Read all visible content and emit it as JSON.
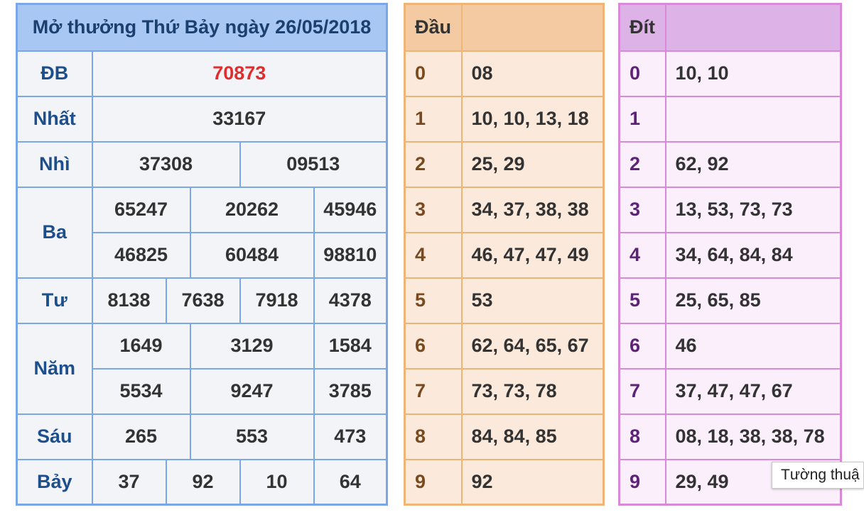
{
  "results": {
    "title": "Mở thưởng Thứ Bảy ngày 26/05/2018",
    "rows": {
      "db": {
        "label": "ĐB",
        "values": [
          "70873"
        ]
      },
      "nhat": {
        "label": "Nhất",
        "values": [
          "33167"
        ]
      },
      "nhi": {
        "label": "Nhì",
        "values": [
          "37308",
          "09513"
        ]
      },
      "ba": {
        "label": "Ba",
        "values": [
          "65247",
          "20262",
          "45946",
          "46825",
          "60484",
          "98810"
        ]
      },
      "tu": {
        "label": "Tư",
        "values": [
          "8138",
          "7638",
          "7918",
          "4378"
        ]
      },
      "nam": {
        "label": "Năm",
        "values": [
          "1649",
          "3129",
          "1584",
          "5534",
          "9247",
          "3785"
        ]
      },
      "sau": {
        "label": "Sáu",
        "values": [
          "265",
          "553",
          "473"
        ]
      },
      "bay": {
        "label": "Bảy",
        "values": [
          "37",
          "92",
          "10",
          "64"
        ]
      }
    },
    "colors": {
      "border": "#7aa7e8",
      "header_bg": "#a9c7f3",
      "special_prize": "#e02d2d",
      "label": "#1d4f8c"
    }
  },
  "dau": {
    "header": "Đầu",
    "rows": [
      {
        "digit": "0",
        "values": "08"
      },
      {
        "digit": "1",
        "values": "10, 10, 13, 18"
      },
      {
        "digit": "2",
        "values": "25, 29"
      },
      {
        "digit": "3",
        "values": "34, 37, 38, 38"
      },
      {
        "digit": "4",
        "values": "46, 47, 47, 49"
      },
      {
        "digit": "5",
        "values": "53"
      },
      {
        "digit": "6",
        "values": "62, 64, 65, 67"
      },
      {
        "digit": "7",
        "values": "73, 73, 78"
      },
      {
        "digit": "8",
        "values": "84, 84, 85"
      },
      {
        "digit": "9",
        "values": "92"
      }
    ],
    "colors": {
      "border": "#efb577",
      "header_bg": "#f3caa1",
      "digit": "#7a4a1e"
    }
  },
  "dit": {
    "header": "Đít",
    "rows": [
      {
        "digit": "0",
        "values": "10, 10"
      },
      {
        "digit": "1",
        "values": ""
      },
      {
        "digit": "2",
        "values": "62, 92"
      },
      {
        "digit": "3",
        "values": "13, 53, 73, 73"
      },
      {
        "digit": "4",
        "values": "34, 64, 84, 84"
      },
      {
        "digit": "5",
        "values": "25, 65, 85"
      },
      {
        "digit": "6",
        "values": "46"
      },
      {
        "digit": "7",
        "values": "37, 47, 47, 67"
      },
      {
        "digit": "8",
        "values": "08, 18, 38, 38, 78"
      },
      {
        "digit": "9",
        "values": "29, 49"
      }
    ],
    "colors": {
      "border": "#d88ad8",
      "header_bg": "#ddb2e7",
      "digit": "#5e2378"
    }
  },
  "tooltip": {
    "text": "Tường thuậ"
  }
}
